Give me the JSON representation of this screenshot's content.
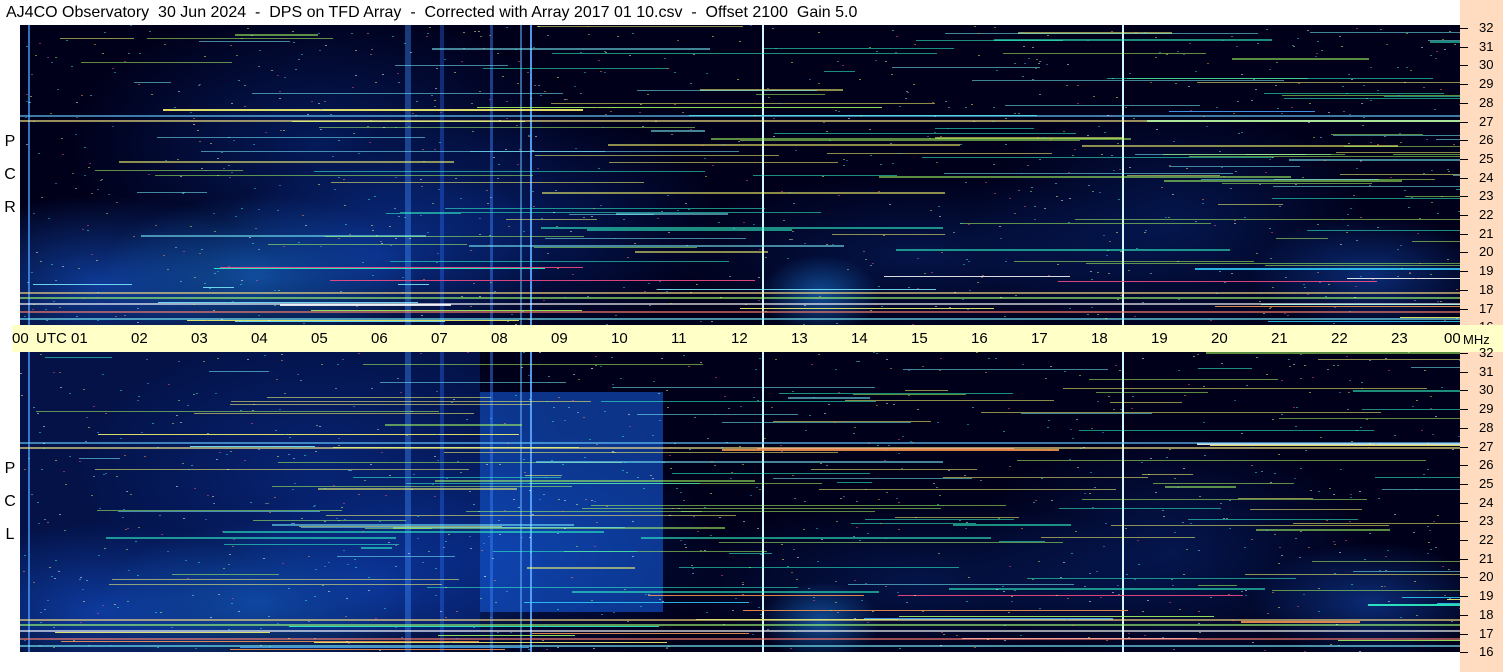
{
  "header": {
    "title": "AJ4CO Observatory  30 Jun 2024  -  DPS on TFD Array  -  Corrected with Array 2017 01 10.csv  -  Offset 2100  Gain 5.0"
  },
  "panels": [
    {
      "id": "rcp",
      "polarization_letters": [
        "R",
        "C",
        "P"
      ]
    },
    {
      "id": "lcp",
      "polarization_letters": [
        "L",
        "C",
        "P"
      ]
    }
  ],
  "time_axis": {
    "labels": [
      "00",
      "UTC",
      "01",
      "02",
      "03",
      "04",
      "05",
      "06",
      "07",
      "08",
      "09",
      "10",
      "11",
      "12",
      "13",
      "14",
      "15",
      "16",
      "17",
      "18",
      "19",
      "20",
      "21",
      "22",
      "23",
      "00"
    ],
    "unit": "MHz"
  },
  "frequency_axis": {
    "labels": [
      "32",
      "31",
      "30",
      "29",
      "28",
      "27",
      "26",
      "25",
      "24",
      "23",
      "22",
      "21",
      "20",
      "19",
      "18",
      "17",
      "16"
    ],
    "min_mhz": 16,
    "max_mhz": 32
  },
  "colors": {
    "background": "#000018",
    "time_axis_bg": "#ffffc8",
    "freq_axis_bg": "#ffdcc0"
  }
}
